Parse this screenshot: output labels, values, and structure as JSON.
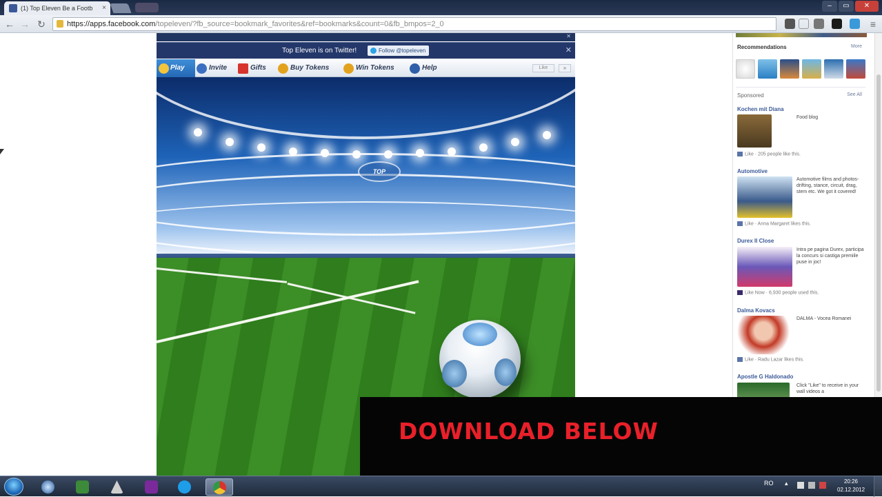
{
  "browser": {
    "tab_title": "(1) Top Eleven Be a Footb",
    "tab_close": "×",
    "url_host": "https://apps.facebook.com",
    "url_path": "/topeleven/?fb_source=bookmark_favorites&ref=bookmarks&count=0&fb_bmpos=2_0",
    "win_minimize": "–",
    "win_maximize": "▭",
    "win_close": "✕",
    "back": "←",
    "forward": "→",
    "reload": "↻",
    "menu": "≡"
  },
  "app": {
    "twitter_text": "Top Eleven is on Twitter!",
    "twitter_follow": "Follow @topeleven",
    "twitter_close": "✕",
    "notice_close": "✕",
    "nav": [
      {
        "label": "Play",
        "icon": "play-icon",
        "color": "#f3c53d"
      },
      {
        "label": "Invite",
        "icon": "invite-icon",
        "color": "#3b6fc2"
      },
      {
        "label": "Gifts",
        "icon": "gift-icon",
        "color": "#d6342c"
      },
      {
        "label": "Buy Tokens",
        "icon": "token-icon",
        "color": "#e3a21e"
      },
      {
        "label": "Win Tokens",
        "icon": "token-icon",
        "color": "#e3a21e"
      },
      {
        "label": "Help",
        "icon": "help-icon",
        "color": "#2f5fa8"
      }
    ],
    "like_label": "Like",
    "scroll_label": "»",
    "stadium_logo": "TOP"
  },
  "sidebar": {
    "recommendations_title": "Recommendations",
    "recommendations_more": "More",
    "sponsored_title": "Sponsored",
    "sponsored_see_all": "See All",
    "ads": [
      {
        "title": "Kochen mit Diana",
        "text": "Food blog",
        "likes": "Like · 205 people like this.",
        "color": "#6b4a2a"
      },
      {
        "title": "Automotive",
        "text": "Automotive films and photos- drifting, stance, circuit, drag, stem etc. We got it covered!",
        "likes": "Like · Anna Margaret likes this.",
        "color": "#4a5f8a"
      },
      {
        "title": "Durex II Close",
        "text": "Intra pe pagina Durex, participa la concurs si castiga premiile puse in joc!",
        "likes": "Like Now · 6,930 people used this.",
        "color": "#5a4fa0"
      },
      {
        "title": "Dalma Kovacs",
        "text": "DALMA - Vocea Romanei",
        "likes": "Like · Radu Lazar likes this.",
        "color": "#c23a26"
      },
      {
        "title": "Apostle G Haldonado",
        "text": "Click \"Like\" to receive in your wall videos a",
        "likes": "",
        "color": "#3a6a3a"
      }
    ]
  },
  "banner": {
    "text": "DOWNLOAD BELOW"
  },
  "taskbar": {
    "tray_lang": "RO",
    "clock_time": "20:26",
    "clock_date": "02.12.2012"
  }
}
